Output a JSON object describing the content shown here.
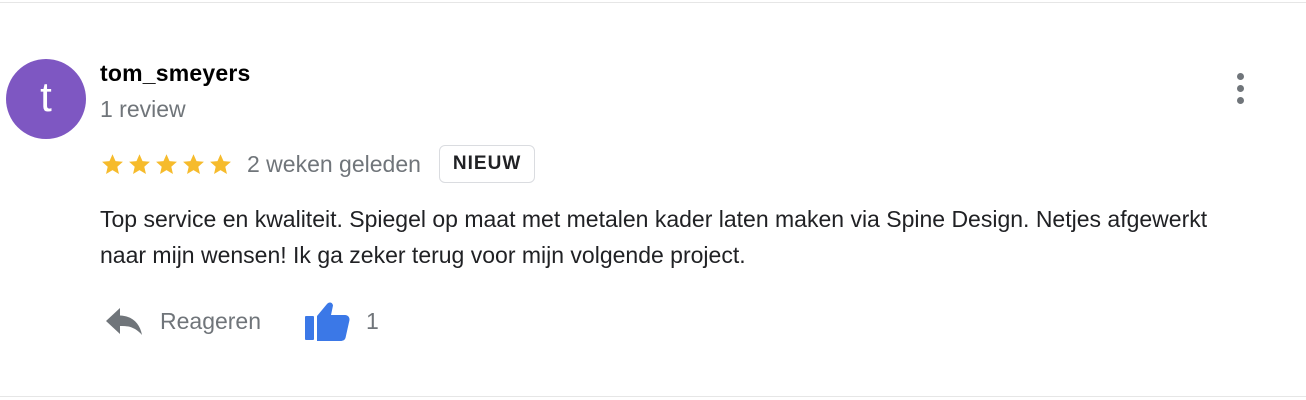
{
  "review": {
    "avatar_letter": "t",
    "avatar_color": "#7e57c2",
    "author": "tom_smeyers",
    "review_count": "1 review",
    "rating": 5,
    "rating_max": 5,
    "star_color": "#f6bb2c",
    "date": "2 weken geleden",
    "badge": "NIEUW",
    "text": "Top service en kwaliteit. Spiegel op maat met metalen kader laten maken via Spine Design. Netjes afgewerkt naar mijn wensen! Ik ga zeker terug voor mijn volgende project.",
    "actions": {
      "reply_label": "Reageren",
      "reply_icon": "reply-arrow-icon",
      "like_icon": "thumbs-up-icon",
      "like_color": "#3b78e7",
      "like_count": "1"
    },
    "more_icon": "more-vertical-icon"
  }
}
